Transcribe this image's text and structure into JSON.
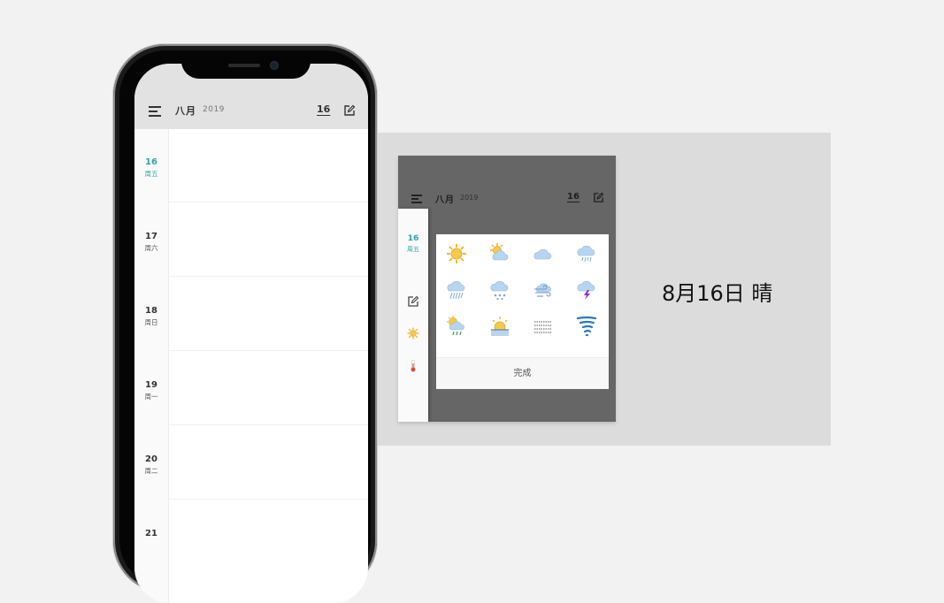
{
  "header": {
    "month": "八月",
    "year": "2019",
    "today": "16"
  },
  "days": [
    {
      "num": "16",
      "weekday": "周五",
      "active": true
    },
    {
      "num": "17",
      "weekday": "周六"
    },
    {
      "num": "18",
      "weekday": "周日"
    },
    {
      "num": "19",
      "weekday": "周一"
    },
    {
      "num": "20",
      "weekday": "周二"
    },
    {
      "num": "21",
      "weekday": ""
    }
  ],
  "preview": {
    "month": "八月",
    "year": "2019",
    "today": "16",
    "selected_day": {
      "num": "16",
      "weekday": "周五"
    },
    "weather_icons": [
      "sunny-icon",
      "partly-cloudy-icon",
      "cloudy-icon",
      "rain-icon",
      "heavy-rain-icon",
      "snow-icon",
      "wind-icon",
      "thunderstorm-icon",
      "sun-rain-icon",
      "sunrise-icon",
      "fog-icon",
      "tornado-icon"
    ],
    "done_label": "完成",
    "colors": {
      "accent": "#2aa6a6",
      "sun": "#f5b020",
      "cloud": "#a9cbea",
      "bolt": "#8a2be2"
    }
  },
  "caption": "8月16日 晴"
}
